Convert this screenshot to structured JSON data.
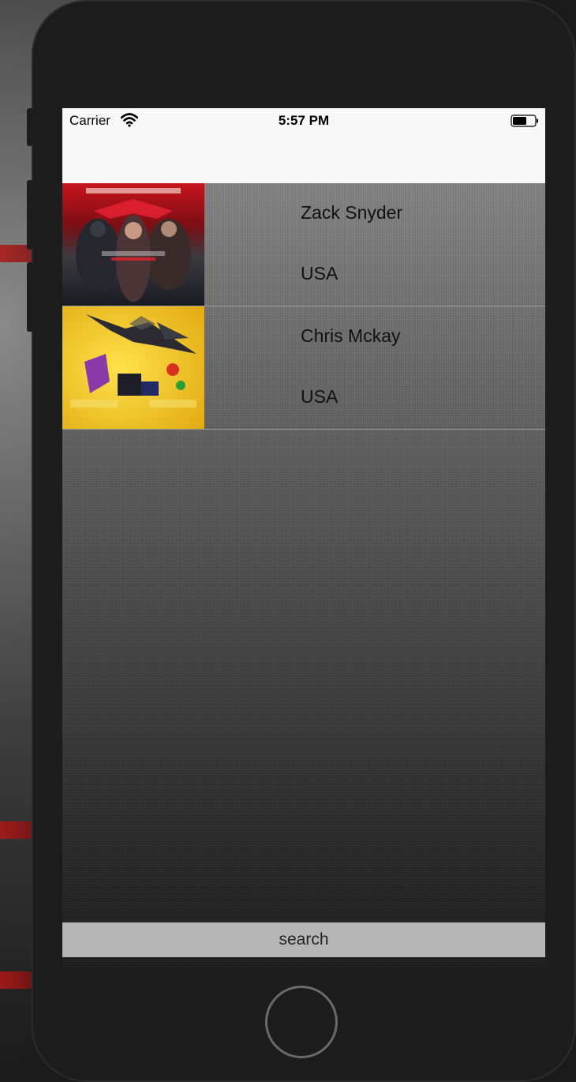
{
  "status_bar": {
    "carrier": "Carrier",
    "time": "5:57 PM",
    "wifi_icon": "wifi-icon",
    "battery_icon": "battery-icon"
  },
  "list": {
    "items": [
      {
        "title": "Zack Snyder",
        "subtitle": "USA",
        "poster_icon": "movie-poster-image"
      },
      {
        "title": "Chris Mckay",
        "subtitle": "USA",
        "poster_icon": "movie-poster-image"
      }
    ]
  },
  "search": {
    "label": "search"
  },
  "colors": {
    "status_bar_bg": "#f8f8f8",
    "search_bar_bg": "#b6b6b6",
    "poster1_accent": "#c8141e",
    "poster2_accent": "#f2c81a"
  }
}
